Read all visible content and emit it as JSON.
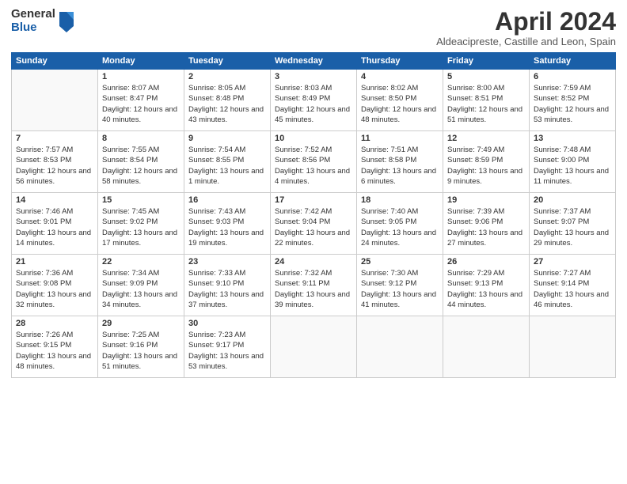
{
  "logo": {
    "general": "General",
    "blue": "Blue"
  },
  "title": "April 2024",
  "location": "Aldeacipreste, Castille and Leon, Spain",
  "weekdays": [
    "Sunday",
    "Monday",
    "Tuesday",
    "Wednesday",
    "Thursday",
    "Friday",
    "Saturday"
  ],
  "weeks": [
    [
      {
        "day": "",
        "sunrise": "",
        "sunset": "",
        "daylight": ""
      },
      {
        "day": "1",
        "sunrise": "Sunrise: 8:07 AM",
        "sunset": "Sunset: 8:47 PM",
        "daylight": "Daylight: 12 hours and 40 minutes."
      },
      {
        "day": "2",
        "sunrise": "Sunrise: 8:05 AM",
        "sunset": "Sunset: 8:48 PM",
        "daylight": "Daylight: 12 hours and 43 minutes."
      },
      {
        "day": "3",
        "sunrise": "Sunrise: 8:03 AM",
        "sunset": "Sunset: 8:49 PM",
        "daylight": "Daylight: 12 hours and 45 minutes."
      },
      {
        "day": "4",
        "sunrise": "Sunrise: 8:02 AM",
        "sunset": "Sunset: 8:50 PM",
        "daylight": "Daylight: 12 hours and 48 minutes."
      },
      {
        "day": "5",
        "sunrise": "Sunrise: 8:00 AM",
        "sunset": "Sunset: 8:51 PM",
        "daylight": "Daylight: 12 hours and 51 minutes."
      },
      {
        "day": "6",
        "sunrise": "Sunrise: 7:59 AM",
        "sunset": "Sunset: 8:52 PM",
        "daylight": "Daylight: 12 hours and 53 minutes."
      }
    ],
    [
      {
        "day": "7",
        "sunrise": "Sunrise: 7:57 AM",
        "sunset": "Sunset: 8:53 PM",
        "daylight": "Daylight: 12 hours and 56 minutes."
      },
      {
        "day": "8",
        "sunrise": "Sunrise: 7:55 AM",
        "sunset": "Sunset: 8:54 PM",
        "daylight": "Daylight: 12 hours and 58 minutes."
      },
      {
        "day": "9",
        "sunrise": "Sunrise: 7:54 AM",
        "sunset": "Sunset: 8:55 PM",
        "daylight": "Daylight: 13 hours and 1 minute."
      },
      {
        "day": "10",
        "sunrise": "Sunrise: 7:52 AM",
        "sunset": "Sunset: 8:56 PM",
        "daylight": "Daylight: 13 hours and 4 minutes."
      },
      {
        "day": "11",
        "sunrise": "Sunrise: 7:51 AM",
        "sunset": "Sunset: 8:58 PM",
        "daylight": "Daylight: 13 hours and 6 minutes."
      },
      {
        "day": "12",
        "sunrise": "Sunrise: 7:49 AM",
        "sunset": "Sunset: 8:59 PM",
        "daylight": "Daylight: 13 hours and 9 minutes."
      },
      {
        "day": "13",
        "sunrise": "Sunrise: 7:48 AM",
        "sunset": "Sunset: 9:00 PM",
        "daylight": "Daylight: 13 hours and 11 minutes."
      }
    ],
    [
      {
        "day": "14",
        "sunrise": "Sunrise: 7:46 AM",
        "sunset": "Sunset: 9:01 PM",
        "daylight": "Daylight: 13 hours and 14 minutes."
      },
      {
        "day": "15",
        "sunrise": "Sunrise: 7:45 AM",
        "sunset": "Sunset: 9:02 PM",
        "daylight": "Daylight: 13 hours and 17 minutes."
      },
      {
        "day": "16",
        "sunrise": "Sunrise: 7:43 AM",
        "sunset": "Sunset: 9:03 PM",
        "daylight": "Daylight: 13 hours and 19 minutes."
      },
      {
        "day": "17",
        "sunrise": "Sunrise: 7:42 AM",
        "sunset": "Sunset: 9:04 PM",
        "daylight": "Daylight: 13 hours and 22 minutes."
      },
      {
        "day": "18",
        "sunrise": "Sunrise: 7:40 AM",
        "sunset": "Sunset: 9:05 PM",
        "daylight": "Daylight: 13 hours and 24 minutes."
      },
      {
        "day": "19",
        "sunrise": "Sunrise: 7:39 AM",
        "sunset": "Sunset: 9:06 PM",
        "daylight": "Daylight: 13 hours and 27 minutes."
      },
      {
        "day": "20",
        "sunrise": "Sunrise: 7:37 AM",
        "sunset": "Sunset: 9:07 PM",
        "daylight": "Daylight: 13 hours and 29 minutes."
      }
    ],
    [
      {
        "day": "21",
        "sunrise": "Sunrise: 7:36 AM",
        "sunset": "Sunset: 9:08 PM",
        "daylight": "Daylight: 13 hours and 32 minutes."
      },
      {
        "day": "22",
        "sunrise": "Sunrise: 7:34 AM",
        "sunset": "Sunset: 9:09 PM",
        "daylight": "Daylight: 13 hours and 34 minutes."
      },
      {
        "day": "23",
        "sunrise": "Sunrise: 7:33 AM",
        "sunset": "Sunset: 9:10 PM",
        "daylight": "Daylight: 13 hours and 37 minutes."
      },
      {
        "day": "24",
        "sunrise": "Sunrise: 7:32 AM",
        "sunset": "Sunset: 9:11 PM",
        "daylight": "Daylight: 13 hours and 39 minutes."
      },
      {
        "day": "25",
        "sunrise": "Sunrise: 7:30 AM",
        "sunset": "Sunset: 9:12 PM",
        "daylight": "Daylight: 13 hours and 41 minutes."
      },
      {
        "day": "26",
        "sunrise": "Sunrise: 7:29 AM",
        "sunset": "Sunset: 9:13 PM",
        "daylight": "Daylight: 13 hours and 44 minutes."
      },
      {
        "day": "27",
        "sunrise": "Sunrise: 7:27 AM",
        "sunset": "Sunset: 9:14 PM",
        "daylight": "Daylight: 13 hours and 46 minutes."
      }
    ],
    [
      {
        "day": "28",
        "sunrise": "Sunrise: 7:26 AM",
        "sunset": "Sunset: 9:15 PM",
        "daylight": "Daylight: 13 hours and 48 minutes."
      },
      {
        "day": "29",
        "sunrise": "Sunrise: 7:25 AM",
        "sunset": "Sunset: 9:16 PM",
        "daylight": "Daylight: 13 hours and 51 minutes."
      },
      {
        "day": "30",
        "sunrise": "Sunrise: 7:23 AM",
        "sunset": "Sunset: 9:17 PM",
        "daylight": "Daylight: 13 hours and 53 minutes."
      },
      {
        "day": "",
        "sunrise": "",
        "sunset": "",
        "daylight": ""
      },
      {
        "day": "",
        "sunrise": "",
        "sunset": "",
        "daylight": ""
      },
      {
        "day": "",
        "sunrise": "",
        "sunset": "",
        "daylight": ""
      },
      {
        "day": "",
        "sunrise": "",
        "sunset": "",
        "daylight": ""
      }
    ]
  ]
}
